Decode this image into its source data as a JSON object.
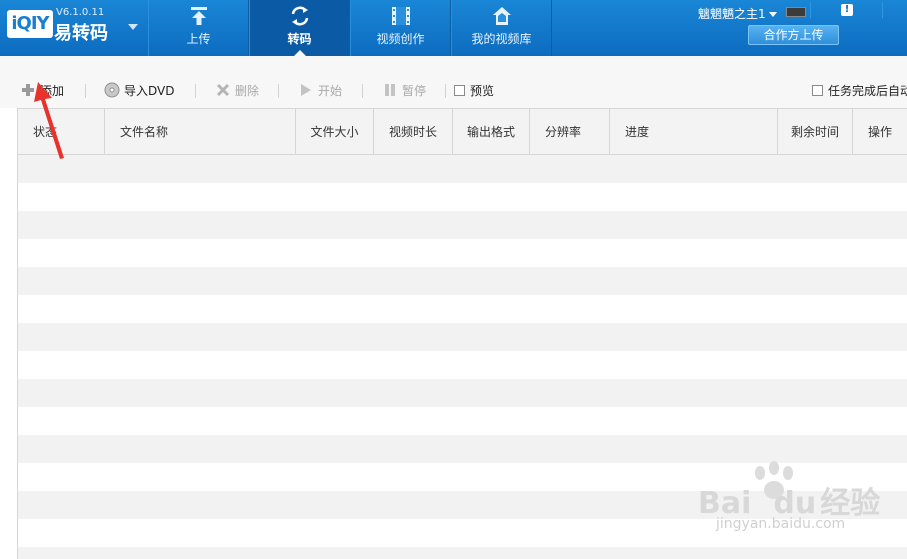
{
  "app": {
    "logo_text": "iQIY",
    "version": "V6.1.0.11",
    "name": "易转码"
  },
  "nav": {
    "tabs": [
      {
        "label": "上传",
        "icon": "upload-icon",
        "active": false
      },
      {
        "label": "转码",
        "icon": "transcode-icon",
        "active": true
      },
      {
        "label": "视频创作",
        "icon": "film-icon",
        "active": false
      },
      {
        "label": "我的视频库",
        "icon": "home-icon",
        "active": false
      }
    ]
  },
  "account": {
    "username": "魑魍魉之主1",
    "notice_glyph": "!",
    "partner_upload_label": "合作方上传"
  },
  "toolbar": {
    "add_label": "添加",
    "import_dvd_label": "导入DVD",
    "delete_label": "删除",
    "start_label": "开始",
    "pause_label": "暂停",
    "preview_label": "预览",
    "auto_after_complete_label": "任务完成后自动"
  },
  "table": {
    "columns": [
      "状态",
      "文件名称",
      "文件大小",
      "视频时长",
      "输出格式",
      "分辨率",
      "进度",
      "剩余时间",
      "操作"
    ],
    "rows": []
  },
  "watermark": {
    "brand": "Bai",
    "brand_suffix": "du",
    "product": "经验",
    "url": "jingyan.baidu.com"
  },
  "colors": {
    "topbar": "#0d6cbf",
    "active_tab": "#0b5aa6",
    "annotation_arrow": "#e8322d"
  }
}
